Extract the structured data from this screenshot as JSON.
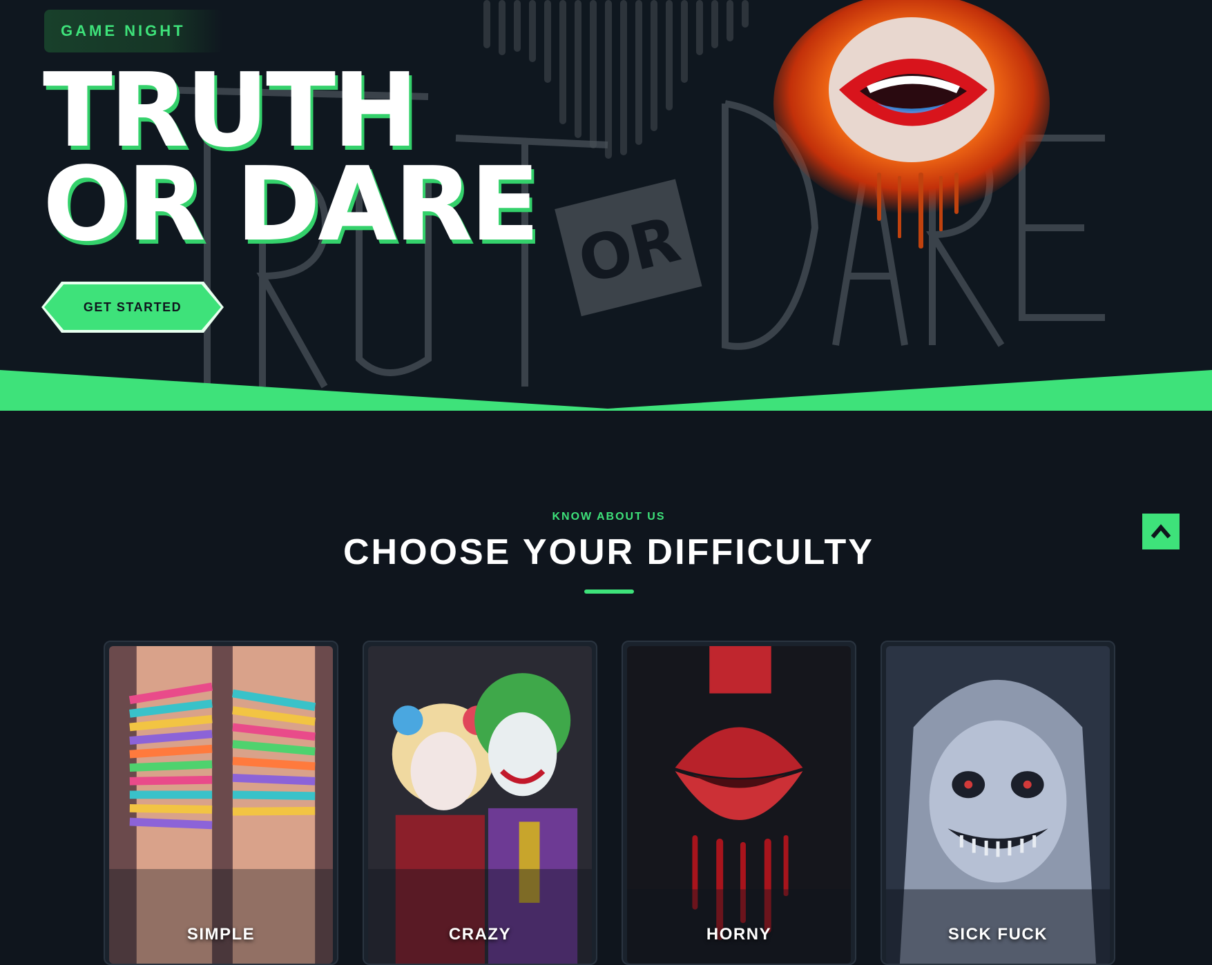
{
  "hero": {
    "tag": "GAME NIGHT",
    "title_line1": "TRUTH",
    "title_line2": "OR DARE",
    "cta": "GET STARTED"
  },
  "section": {
    "kicker": "KNOW ABOUT US",
    "title": "CHOOSE YOUR DIFFICULTY"
  },
  "cards": [
    {
      "label": "SIMPLE"
    },
    {
      "label": "CRAZY"
    },
    {
      "label": "HORNY"
    },
    {
      "label": "SICK FUCK"
    }
  ],
  "colors": {
    "accent": "#3ee27a",
    "background": "#0f151d",
    "card": "#1a222c"
  },
  "icons": {
    "scroll_top": "chevron-up-icon"
  }
}
